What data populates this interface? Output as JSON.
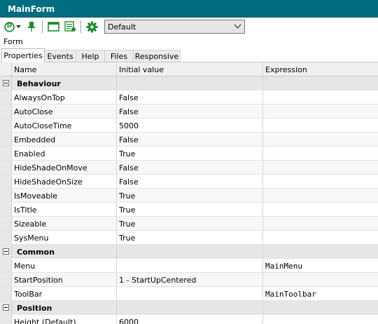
{
  "window": {
    "title": "MainForm"
  },
  "toolbar": {
    "dropdown_icon_letter": "D",
    "combo_value": "Default",
    "icons": [
      "d-circle-icon",
      "pin-icon",
      "window-icon",
      "form-list-icon",
      "gear-icon"
    ],
    "accent": "#1d8f2e"
  },
  "form_label": "Form",
  "tabs": [
    {
      "label": "Properties",
      "active": true
    },
    {
      "label": "Events"
    },
    {
      "label": "Help"
    },
    {
      "label": "Files"
    },
    {
      "label": "Responsive"
    }
  ],
  "grid": {
    "columns": [
      "Name",
      "Initial value",
      "Expression"
    ],
    "sections": [
      {
        "label": "Behaviour",
        "rows": [
          {
            "name": "AlwaysOnTop",
            "initial": "False",
            "expression": ""
          },
          {
            "name": "AutoClose",
            "initial": "False",
            "expression": ""
          },
          {
            "name": "AutoCloseTime",
            "initial": "5000",
            "expression": ""
          },
          {
            "name": "Embedded",
            "initial": "False",
            "expression": ""
          },
          {
            "name": "Enabled",
            "initial": "True",
            "expression": ""
          },
          {
            "name": "HideShadeOnMove",
            "initial": "False",
            "expression": ""
          },
          {
            "name": "HideShadeOnSize",
            "initial": "False",
            "expression": ""
          },
          {
            "name": "IsMoveable",
            "initial": "True",
            "expression": ""
          },
          {
            "name": "IsTitle",
            "initial": "True",
            "expression": ""
          },
          {
            "name": "Sizeable",
            "initial": "True",
            "expression": ""
          },
          {
            "name": "SysMenu",
            "initial": "True",
            "expression": ""
          }
        ]
      },
      {
        "label": "Common",
        "rows": [
          {
            "name": "Menu",
            "initial": "",
            "expression": "MainMenu"
          },
          {
            "name": "StartPosition",
            "initial": "1 - StartUpCentered",
            "expression": ""
          },
          {
            "name": "ToolBar",
            "initial": "",
            "expression": "MainToolbar"
          }
        ]
      },
      {
        "label": "Position",
        "rows": [
          {
            "name": "Height (Default)",
            "initial": "6000",
            "expression": ""
          }
        ]
      }
    ]
  }
}
